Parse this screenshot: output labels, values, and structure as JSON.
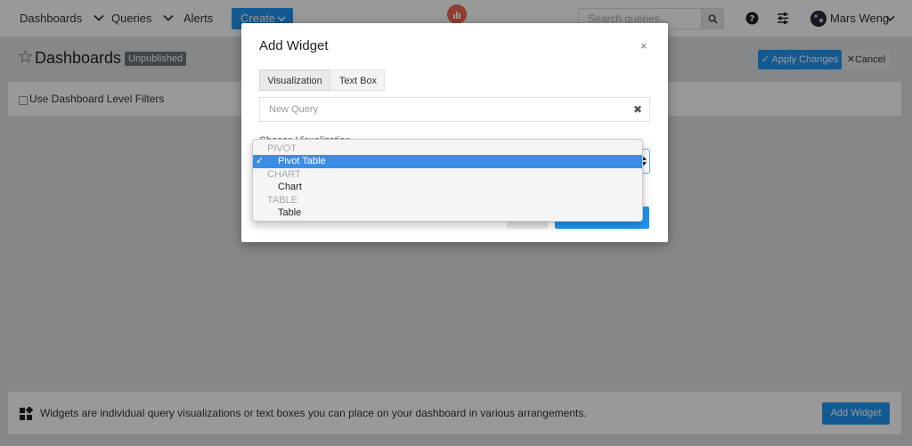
{
  "nav": {
    "dashboards": "Dashboards",
    "queries": "Queries",
    "alerts": "Alerts",
    "create": "Create",
    "search_placeholder": "Search queries...",
    "user_name": "Mars Weng"
  },
  "page": {
    "title": "Dashboards",
    "status_badge": "Unpublished",
    "apply_changes": "✓ Apply Changes",
    "cancel": "✕Cancel",
    "filters_label": "Use Dashboard Level Filters"
  },
  "footer": {
    "text": "Widgets are individual query visualizations or text boxes you can place on your dashboard in various arrangements.",
    "add_widget": "Add Widget"
  },
  "modal": {
    "title": "Add Widget",
    "close": "×",
    "tabs": [
      "Visualization",
      "Text Box"
    ],
    "query_placeholder": "New Query",
    "query_clear": "✖",
    "choose_label": "Choose Visualization"
  },
  "dropdown": {
    "groups": [
      {
        "label": "PIVOT",
        "options": [
          {
            "label": "Pivot Table",
            "selected": true
          }
        ]
      },
      {
        "label": "CHART",
        "options": [
          {
            "label": "Chart",
            "selected": false
          }
        ]
      },
      {
        "label": "TABLE",
        "options": [
          {
            "label": "Table",
            "selected": false
          }
        ]
      }
    ],
    "check_mark": "✓"
  },
  "colors": {
    "primary": "#2196f3",
    "logo": "#f06a53",
    "badge": "#6c757d",
    "selected_option": "#3a8ee6"
  }
}
